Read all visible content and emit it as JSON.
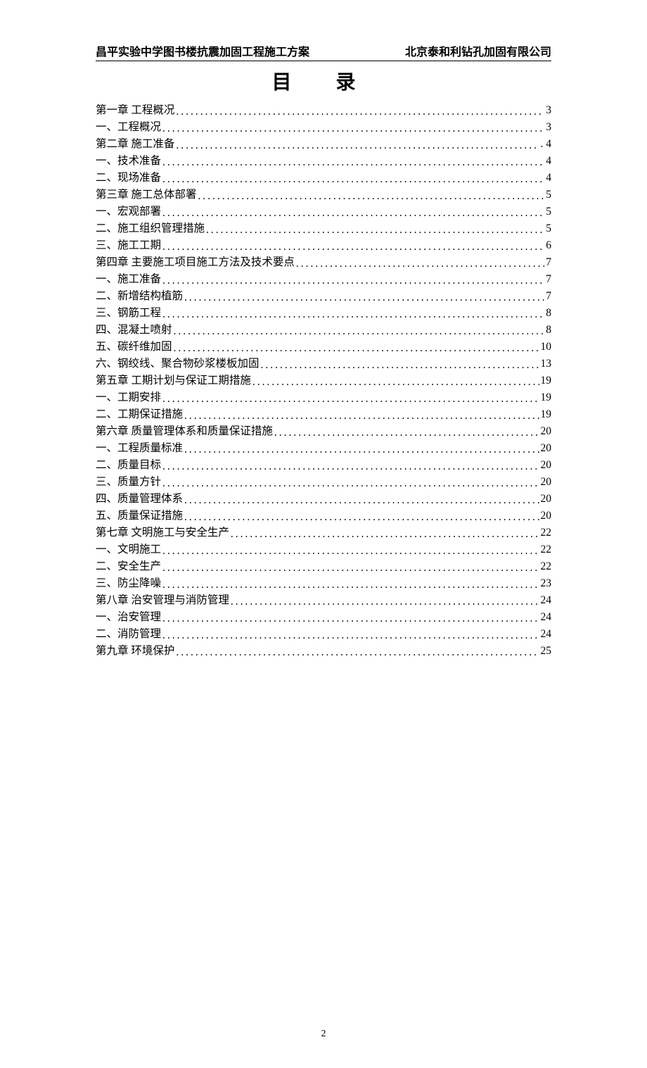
{
  "header": {
    "left": "昌平实验中学图书楼抗震加固工程施工方案",
    "right": "北京泰和利钻孔加固有限公司"
  },
  "title": "目 录",
  "toc": [
    {
      "label": "第一章  工程概况 ",
      "page": "3"
    },
    {
      "label": "一、工程概况",
      "page": "3"
    },
    {
      "label": "第二章  施工准备 ",
      "page": ". 4"
    },
    {
      "label": "一、技术准备",
      "page": "4"
    },
    {
      "label": "二、现场准备",
      "page": "4"
    },
    {
      "label": "第三章  施工总体部署 ",
      "page": "5"
    },
    {
      "label": "一、宏观部署",
      "page": "5"
    },
    {
      "label": "二、施工组织管理措施 ",
      "page": "5"
    },
    {
      "label": "三、施工工期",
      "page": "6"
    },
    {
      "label": "第四章  主要施工项目施工方法及技术要点 ",
      "page": "7"
    },
    {
      "label": "一、施工准备",
      "page": "7"
    },
    {
      "label": "二、新增结构植筋 ",
      "page": "7"
    },
    {
      "label": "三、钢筋工程",
      "page": "8"
    },
    {
      "label": "四、混凝土喷射",
      "page": "8"
    },
    {
      "label": "五、碳纤维加固",
      "page": "10"
    },
    {
      "label": "六、钢绞线、聚合物砂浆楼板加固",
      "page": "13"
    },
    {
      "label": "第五章  工期计划与保证工期措施",
      "page": "19"
    },
    {
      "label": "一、工期安排",
      "page": "19"
    },
    {
      "label": "二、工期保证措施 ",
      "page": "19"
    },
    {
      "label": "第六章  质量管理体系和质量保证措施 ",
      "page": "20"
    },
    {
      "label": "一、工程质量标准 ",
      "page": "20"
    },
    {
      "label": "二、质量目标",
      "page": "20"
    },
    {
      "label": "三、质量方针",
      "page": "20"
    },
    {
      "label": "四、质量管理体系 ",
      "page": "20"
    },
    {
      "label": "五、质量保证措施 ",
      "page": "20"
    },
    {
      "label": "第七章  文明施工与安全生产",
      "page": "22"
    },
    {
      "label": "一、文明施工",
      "page": "22"
    },
    {
      "label": "二、安全生产",
      "page": "22"
    },
    {
      "label": "三、防尘降噪",
      "page": "23"
    },
    {
      "label": "第八章  治安管理与消防管理",
      "page": "24"
    },
    {
      "label": "一、治安管理",
      "page": "24"
    },
    {
      "label": "二、消防管理",
      "page": "24"
    },
    {
      "label": "第九章  环境保护 ",
      "page": "25"
    }
  ],
  "pageNumber": "2"
}
